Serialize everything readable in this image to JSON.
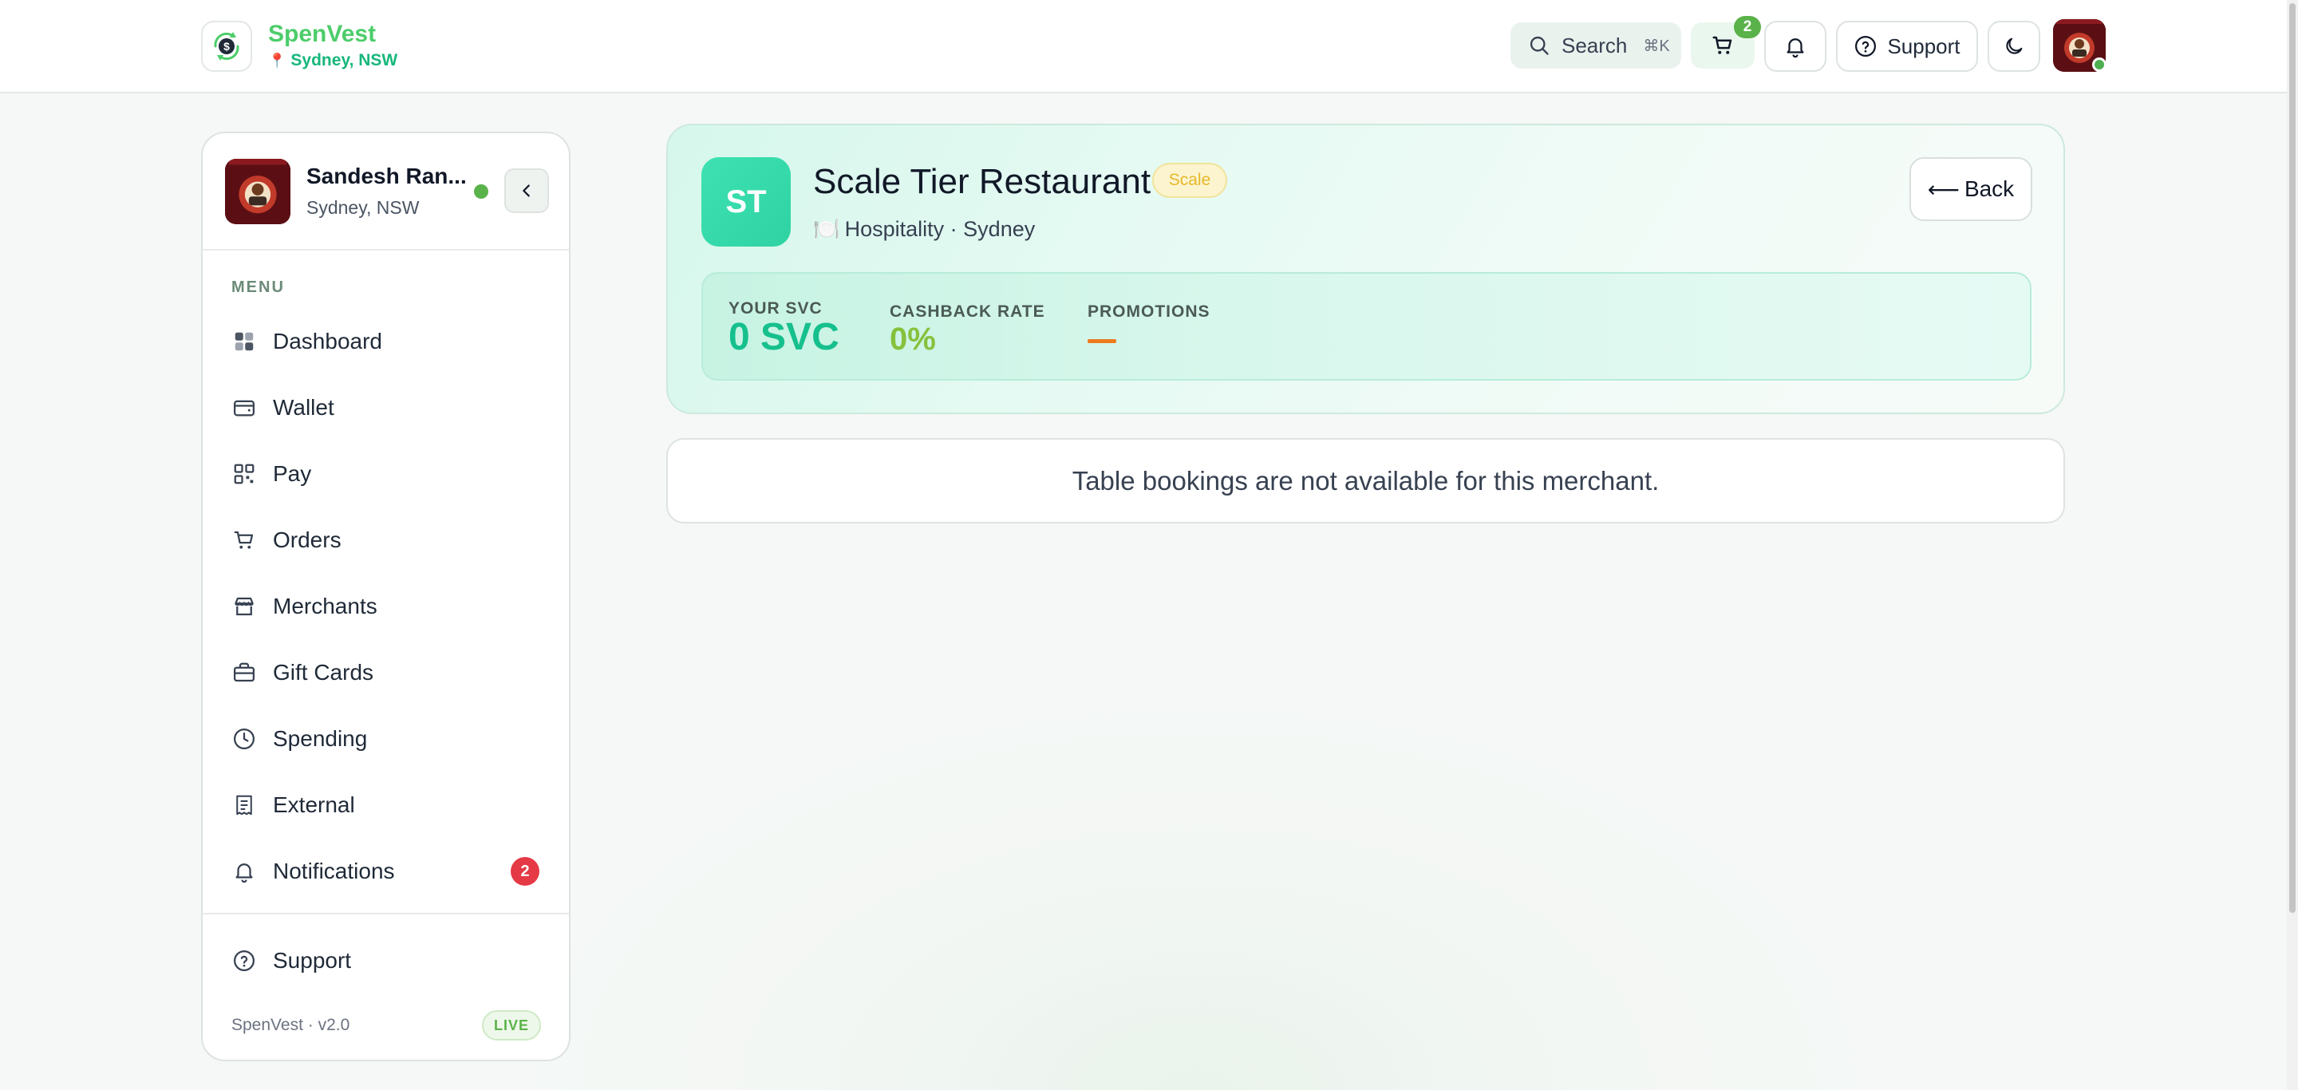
{
  "header": {
    "brand_name": "SpenVest",
    "location": "Sydney, NSW",
    "search_label": "Search",
    "search_shortcut": "⌘K",
    "cart_count": "2",
    "support_label": "Support"
  },
  "sidebar": {
    "user_name": "Sandesh Ran...",
    "user_location": "Sydney, NSW",
    "menu_title": "MENU",
    "items": [
      {
        "label": "Dashboard",
        "icon": "grid-icon"
      },
      {
        "label": "Wallet",
        "icon": "wallet-icon"
      },
      {
        "label": "Pay",
        "icon": "qr-icon"
      },
      {
        "label": "Orders",
        "icon": "cart-icon"
      },
      {
        "label": "Merchants",
        "icon": "store-icon"
      },
      {
        "label": "Gift Cards",
        "icon": "gift-card-icon"
      },
      {
        "label": "Spending",
        "icon": "clock-icon"
      },
      {
        "label": "External",
        "icon": "receipt-icon"
      },
      {
        "label": "Notifications",
        "icon": "bell-icon",
        "badge": "2"
      }
    ],
    "support_label": "Support",
    "version": "SpenVest · v2.0",
    "status": "LIVE"
  },
  "merchant": {
    "initials": "ST",
    "name": "Scale Tier Restaurant",
    "tier": "Scale",
    "category_emoji": "🍽️",
    "subtitle": "Hospitality · Sydney",
    "back_label": "Back",
    "stats": {
      "svc_label": "YOUR SVC",
      "svc_value": "0 SVC",
      "cashback_label": "CASHBACK RATE",
      "cashback_value": "0%",
      "promotions_label": "PROMOTIONS"
    }
  },
  "notice": "Table bookings are not available for this merchant.",
  "colors": {
    "brand_green": "#4ccd6a",
    "accent_teal": "#16c08d",
    "cashback_green": "#86c13d",
    "badge_red": "#e53945",
    "promo_orange": "#ec7a1e"
  }
}
